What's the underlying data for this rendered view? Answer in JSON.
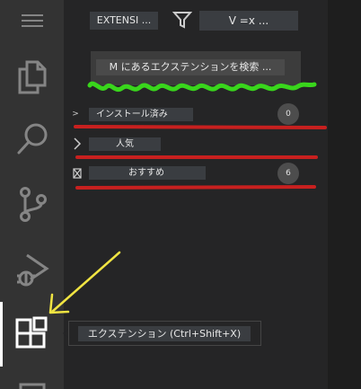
{
  "toolbar": {
    "extensions_label": "EXTENSI ...",
    "views_label": "V =x ..."
  },
  "search": {
    "placeholder": "M にあるエクステンションを検索 ..."
  },
  "sections": [
    {
      "chevron": ">",
      "label": "インストール済み",
      "count": "0"
    },
    {
      "chevron": ">",
      "label": "人気",
      "count": ""
    },
    {
      "chevron": "⊠",
      "label": "おすすめ",
      "count": "6"
    }
  ],
  "tooltip": {
    "text": "エクステンション (Ctrl+Shift+X)"
  },
  "activity_bar": {
    "items": [
      "menu-icon",
      "files-icon",
      "search-icon",
      "source-control-icon",
      "run-debug-icon",
      "extensions-icon",
      "remote-icon"
    ],
    "active": "extensions-icon"
  },
  "annotations": {
    "underline_color": "#c8201f",
    "squiggle_color": "#39d61c",
    "arrow_color": "#f0e442"
  }
}
